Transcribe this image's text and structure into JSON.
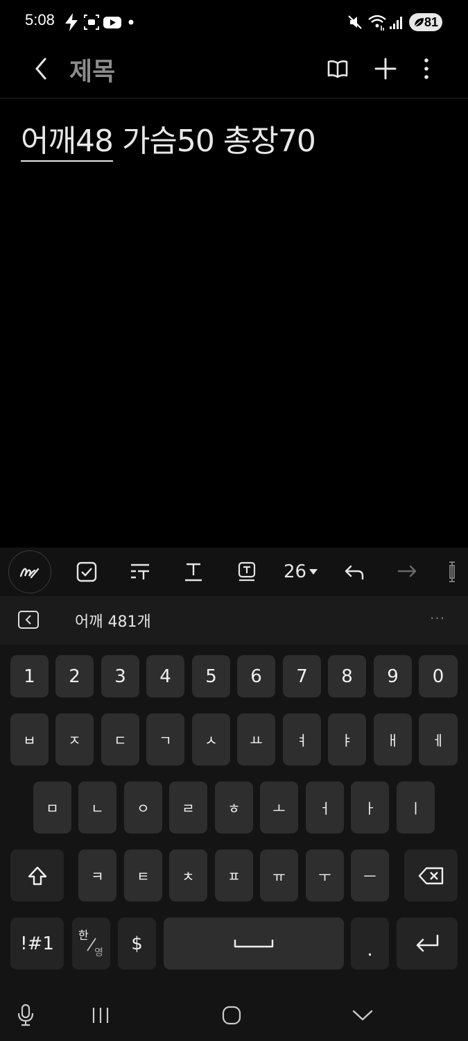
{
  "status_bar": {
    "time": "5:08",
    "battery": "81",
    "icons": [
      "flash-icon",
      "screen-record-icon",
      "youtube-icon",
      "dot-icon",
      "mute-icon",
      "wifi-icon",
      "signal-icon"
    ]
  },
  "app_bar": {
    "title": "제목",
    "icons": [
      "back-icon",
      "reading-mode-icon",
      "add-icon",
      "more-icon"
    ]
  },
  "note": {
    "composing_word": "어깨48",
    "rest_text": " 가슴50 총장70"
  },
  "format_toolbar": {
    "font_size": "26",
    "icons": [
      "pen-icon",
      "checkbox-icon",
      "paragraph-style-icon",
      "text-style-icon",
      "text-box-icon",
      "undo-icon",
      "redo-icon",
      "more-tools-icon"
    ]
  },
  "keyboard": {
    "suggestion": "어깨 481개",
    "more": "···",
    "row_numbers": [
      "1",
      "2",
      "3",
      "4",
      "5",
      "6",
      "7",
      "8",
      "9",
      "0"
    ],
    "row1": [
      "ㅂ",
      "ㅈ",
      "ㄷ",
      "ㄱ",
      "ㅅ",
      "ㅛ",
      "ㅕ",
      "ㅑ",
      "ㅐ",
      "ㅔ"
    ],
    "row2": [
      "ㅁ",
      "ㄴ",
      "ㅇ",
      "ㄹ",
      "ㅎ",
      "ㅗ",
      "ㅓ",
      "ㅏ",
      "ㅣ"
    ],
    "row3": [
      "ㅋ",
      "ㅌ",
      "ㅊ",
      "ㅍ",
      "ㅠ",
      "ㅜ",
      "ㅡ"
    ],
    "symbols": "!#1",
    "lang_top": "한",
    "lang_bottom": "영",
    "dollar": "$",
    "period": "."
  }
}
